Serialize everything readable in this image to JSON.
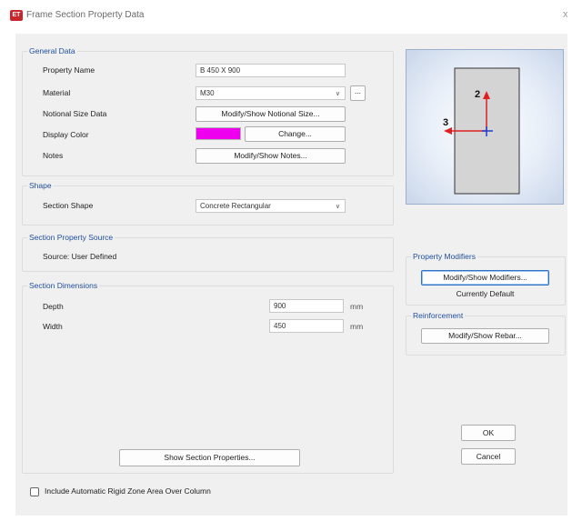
{
  "window": {
    "title": "Frame Section Property Data",
    "icon_text": "ET",
    "close_glyph": "x",
    "accent": "#c8262c"
  },
  "general": {
    "title": "General Data",
    "property_name_label": "Property Name",
    "property_name_value": "B 450 X 900",
    "material_label": "Material",
    "material_value": "M30",
    "material_browse": "...",
    "notional_label": "Notional Size Data",
    "notional_button": "Modify/Show Notional Size...",
    "display_color_label": "Display Color",
    "display_color_swatch": "#ee00ee",
    "change_button": "Change...",
    "notes_label": "Notes",
    "notes_button": "Modify/Show Notes..."
  },
  "shape": {
    "title": "Shape",
    "label": "Section Shape",
    "value": "Concrete Rectangular"
  },
  "source": {
    "title": "Section Property Source",
    "text": "Source:  User Defined"
  },
  "dimensions": {
    "title": "Section Dimensions",
    "depth_label": "Depth",
    "depth_value": "900",
    "depth_unit": "mm",
    "width_label": "Width",
    "width_value": "450",
    "width_unit": "mm"
  },
  "preview": {
    "axis_2": "2",
    "axis_3": "3",
    "axis_color": "#e02020",
    "center_color": "#2040d0"
  },
  "modifiers": {
    "title": "Property Modifiers",
    "button": "Modify/Show Modifiers...",
    "status": "Currently Default"
  },
  "reinforcement": {
    "title": "Reinforcement",
    "button": "Modify/Show Rebar..."
  },
  "buttons": {
    "ok": "OK",
    "cancel": "Cancel",
    "show_props": "Show Section Properties..."
  },
  "rigid_zone": {
    "label": "Include Automatic Rigid Zone Area Over Column",
    "checked": false
  }
}
